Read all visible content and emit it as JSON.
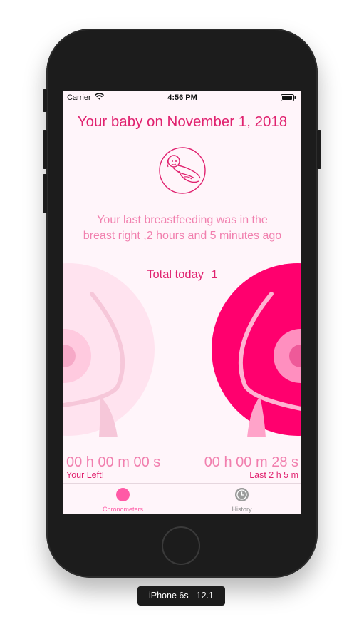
{
  "status_bar": {
    "carrier": "Carrier",
    "time": "4:56 PM"
  },
  "header": {
    "title": "Your baby on November 1, 2018"
  },
  "last_feeding": {
    "line1": "Your last breastfeeding was in the",
    "line2": "breast right ,2 hours and 5 minutes ago"
  },
  "total": {
    "label": "Total today",
    "count": "1"
  },
  "left_breast": {
    "timer": "00 h 00 m 00 s",
    "caption": "Your Left!",
    "active": false
  },
  "right_breast": {
    "timer": "00 h 00 m 28 s",
    "caption": "Last 2 h 5 m",
    "active": true
  },
  "tabs": [
    {
      "label": "Chronometers",
      "selected": true,
      "icon": "circle-icon"
    },
    {
      "label": "History",
      "selected": false,
      "icon": "clock-icon"
    }
  ],
  "device_label": "iPhone 6s - 12.1",
  "colors": {
    "accent": "#e0226f",
    "accent_light": "#f17fae",
    "active_breast": "#ff006e",
    "inactive_breast": "#ffe3ef",
    "tab_selected": "#ff5aa6",
    "tab_unselected": "#9b9b9b"
  }
}
